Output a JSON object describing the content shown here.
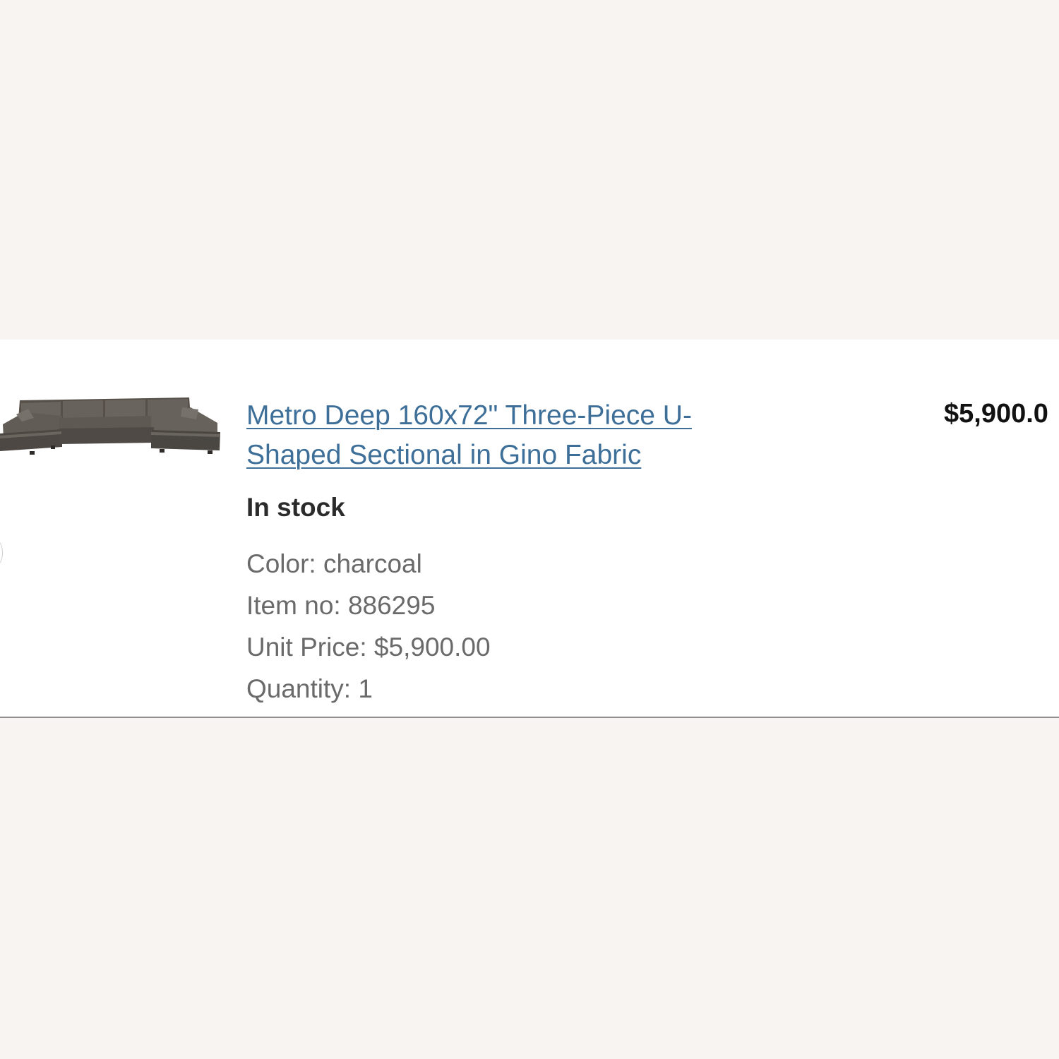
{
  "order_item": {
    "image_alt": "Metro Deep U-shaped sectional sofa image",
    "product_link_line_1": "Metro Deep 160x72\" Three-Piece U-",
    "product_link_line_2": "Shaped Sectional in Gino Fabric",
    "stock_status": "In stock",
    "color": "Color: charcoal",
    "item_no": "Item no: 886295",
    "unit_price": "Unit Price: $5,900.00",
    "quantity": "Quantity: 1",
    "total_price": "$5,900.0"
  },
  "colors": {
    "page_background": "#f7f4f1",
    "card_background": "#ffffff",
    "link": "#3d6f99",
    "secondary_text": "#6a6a6a"
  },
  "icons": {
    "product_image": "sectional-sofa-thumbnail"
  }
}
